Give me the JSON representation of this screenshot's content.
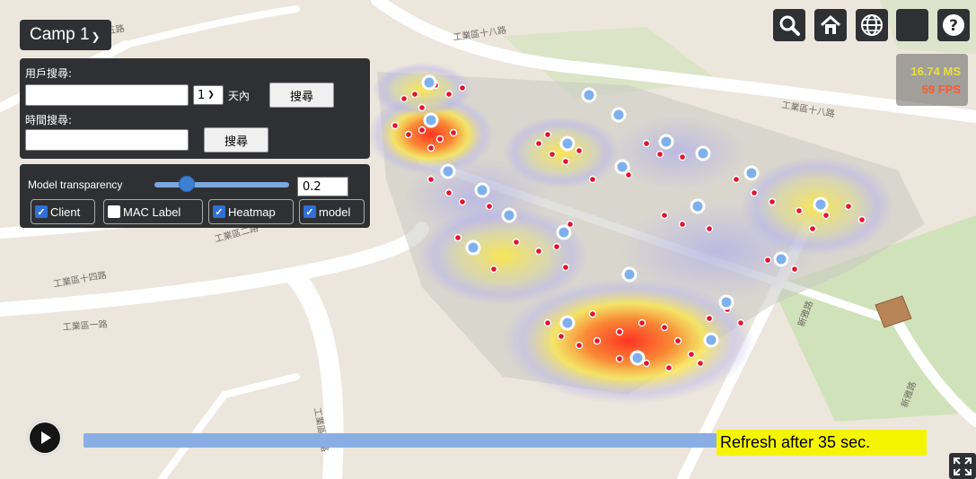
{
  "camp_select": {
    "value": "Camp 1"
  },
  "search": {
    "user_search_label": "用戶搜尋:",
    "user_search_value": "",
    "days_value": "1",
    "days_unit": "天內",
    "user_search_button": "搜尋",
    "time_search_label": "時間搜尋:",
    "time_search_value": "",
    "time_search_button": "搜尋"
  },
  "model": {
    "transparency_label": "Model transparency",
    "transparency_value": "0.2",
    "transparency_level": 0.2,
    "checkboxes": [
      {
        "label": "Client",
        "checked": true
      },
      {
        "label": "MAC Label",
        "checked": false
      },
      {
        "label": "Heatmap",
        "checked": true
      },
      {
        "label": "model",
        "checked": true
      }
    ]
  },
  "toolbar": {
    "icons": [
      "search-icon",
      "home-icon",
      "globe-icon",
      "blank-button",
      "help-icon"
    ]
  },
  "performance": {
    "ms": "16.74 MS",
    "fps": "59 FPS",
    "ms_color": "#e6e23a",
    "fps_color": "#ff5a2a"
  },
  "timeline": {
    "refresh_text": "Refresh after 35 sec."
  },
  "map_labels": {
    "road_1": "工業區一路",
    "road_2": "工業區十四路",
    "road_3": "工業區二路",
    "road_4": "新雅路",
    "road_5": "工業區十五路",
    "road_6": "工業區十八路",
    "road_7": "新雅路",
    "road_8": "工業區十八路",
    "road_9": "工業區二路"
  },
  "colors": {
    "panel": "#2f3033",
    "accent": "#2e6fd8",
    "refresh_bg": "#f5f500",
    "timeline": "#8aaee4"
  }
}
